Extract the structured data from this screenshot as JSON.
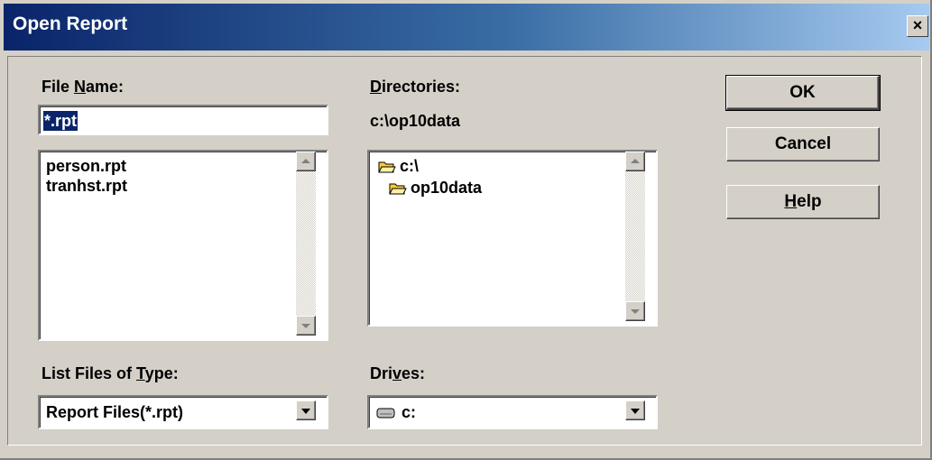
{
  "window": {
    "title": "Open Report",
    "close_glyph": "×"
  },
  "file_name": {
    "label_pre": "File ",
    "label_key": "N",
    "label_post": "ame:",
    "value": "*.rpt",
    "files": [
      "person.rpt",
      "tranhst.rpt"
    ]
  },
  "directories": {
    "label_pre": "",
    "label_key": "D",
    "label_post": "irectories:",
    "current_path": "c:\\op10data",
    "items": [
      "c:\\",
      "op10data"
    ]
  },
  "file_type": {
    "label_pre": "List Files of ",
    "label_key": "T",
    "label_post": "ype:",
    "selected": "Report Files(*.rpt)"
  },
  "drives": {
    "label_pre": "Dri",
    "label_key": "v",
    "label_post": "es:",
    "selected": "c:"
  },
  "buttons": {
    "ok": "OK",
    "cancel": "Cancel",
    "help_key": "H",
    "help_rest": "elp"
  },
  "colors": {
    "face": "#d4d0c8",
    "title_start": "#0a246a",
    "title_end": "#a6caf0",
    "selection": "#0a246a",
    "folder": "#ffcc33"
  },
  "icons": {
    "folder_open": "folder-open-icon",
    "drive": "hard-drive-icon"
  }
}
